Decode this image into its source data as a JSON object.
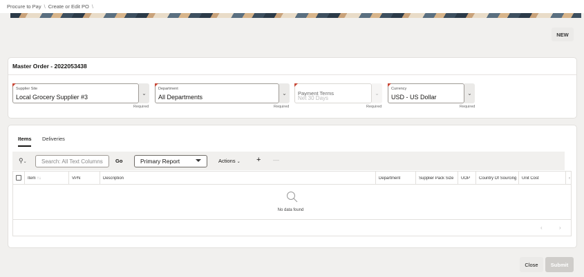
{
  "breadcrumb": {
    "items": [
      "Procure to Pay",
      "Create or Edit PO"
    ],
    "separator": "\\"
  },
  "header": {
    "new_label": "NEW"
  },
  "order": {
    "title": "Master Order - 2022053438",
    "fields": [
      {
        "label": "Supplier Site",
        "value": "Local Grocery Supplier #3",
        "required": "Required"
      },
      {
        "label": "Department",
        "value": "All Departments",
        "required": "Required"
      },
      {
        "label": "Payment Terms",
        "placeholder": "Net 30 Days",
        "required": "Required"
      },
      {
        "label": "Currency",
        "value": "USD - US Dollar",
        "required": "Required"
      }
    ]
  },
  "tabs": [
    {
      "label": "Items",
      "active": true
    },
    {
      "label": "Deliveries",
      "active": false
    }
  ],
  "toolbar": {
    "search_placeholder": "Search: All Text Columns",
    "go_label": "Go",
    "report_label": "Primary Report",
    "actions_label": "Actions",
    "add_label": "+",
    "remove_label": "—"
  },
  "table": {
    "columns": [
      "Item",
      "VPN",
      "Description",
      "Department",
      "Supplier Pack Size",
      "UOP",
      "Country Of Sourcing",
      "Unit Cost"
    ],
    "sort_indicator": "↑↓",
    "empty_text": "No data found"
  },
  "footer": {
    "close_label": "Close",
    "submit_label": "Submit"
  },
  "colors": {
    "required_marker": "#c74634",
    "banner_dark": "#2b3a48",
    "banner_tan": "#c9a27a"
  }
}
